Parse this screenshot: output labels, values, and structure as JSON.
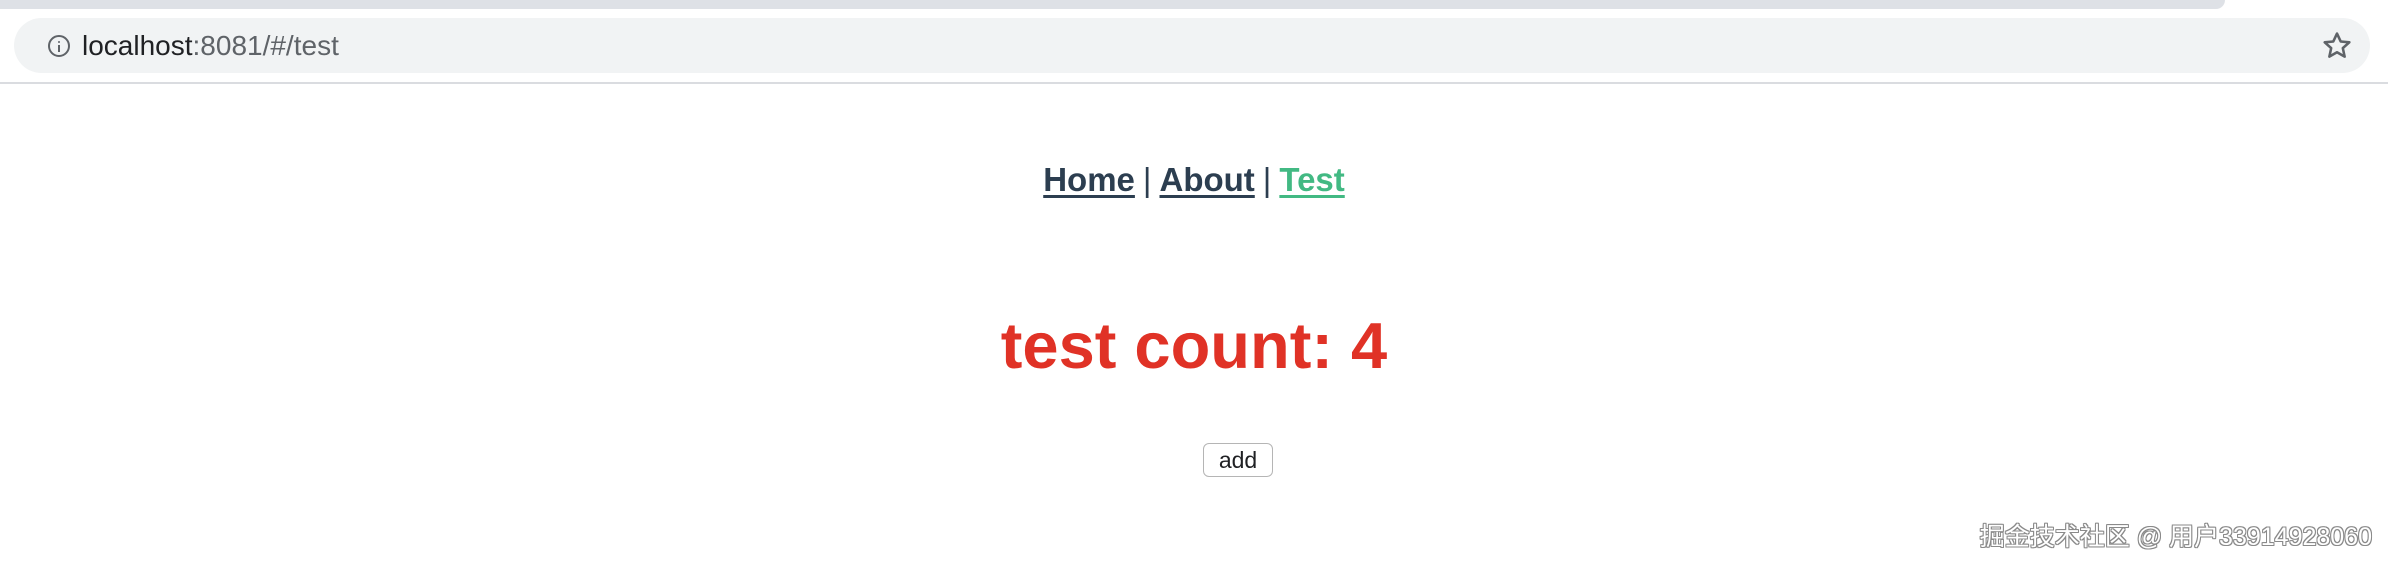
{
  "browser": {
    "url_host": "localhost",
    "url_rest": ":8081/#/test",
    "info_icon": "info-icon",
    "bookmark_icon": "star-icon"
  },
  "nav": {
    "items": [
      {
        "label": "Home",
        "active": false
      },
      {
        "label": "About",
        "active": false
      },
      {
        "label": "Test",
        "active": true
      }
    ],
    "separator": "|",
    "colors": {
      "link": "#2c3e50",
      "active": "#42b983"
    }
  },
  "main": {
    "heading": "test count: 4",
    "heading_color": "#e03226",
    "add_button_label": "add"
  },
  "watermark": "掘金技术社区 @ 用户33914928060"
}
